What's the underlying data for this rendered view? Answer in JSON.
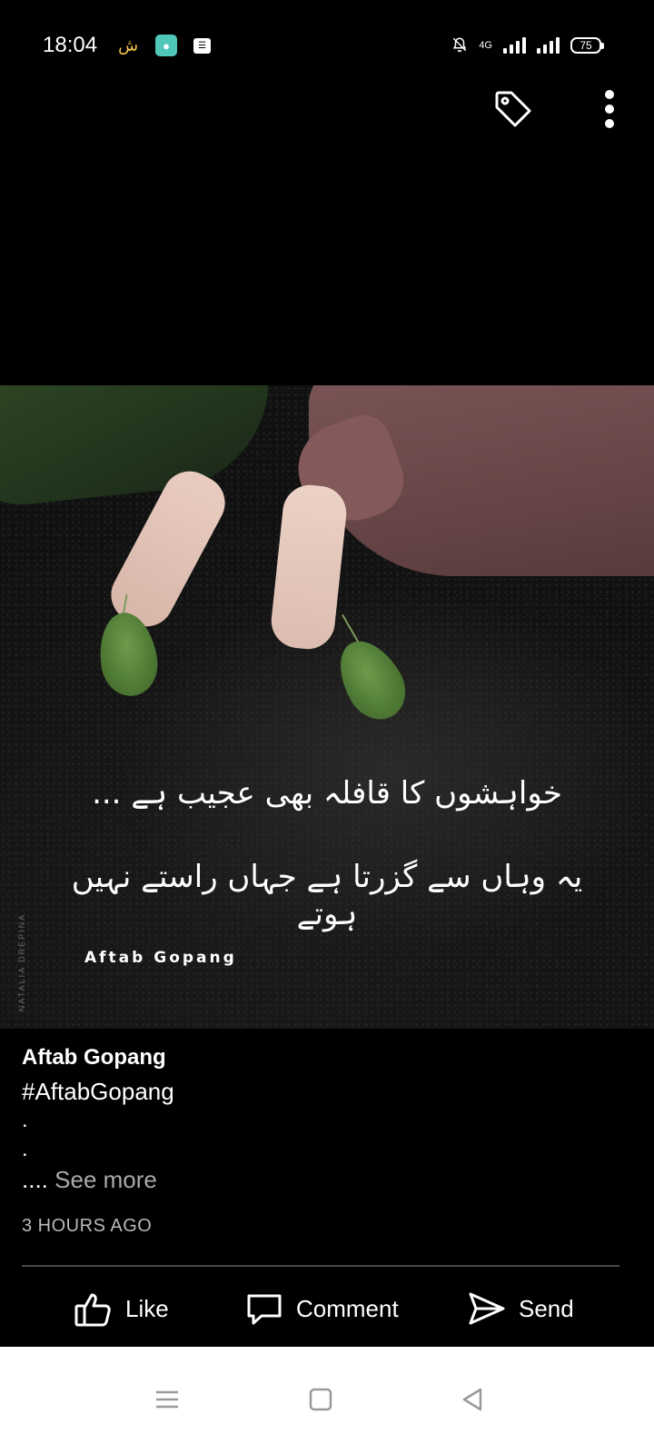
{
  "status_bar": {
    "time": "18:04",
    "network": "4G",
    "battery": "75",
    "icons": [
      "wechat-like-app-icon",
      "chat-app-icon",
      "message-icon",
      "mute-bell-icon",
      "signal-icon",
      "signal-icon"
    ]
  },
  "toolbar": {
    "icons": [
      "tag-icon",
      "more-vertical-icon"
    ]
  },
  "photo": {
    "poetry_line_1": "خواہشوں کا قافلہ بھی عجیب ہے ...",
    "poetry_line_2": "یہ وہاں سے گزرتا ہے جہاں راستے نہیں ہوتے",
    "watermark": "Aftab Gopang",
    "credit": "NATALIA DREPINA"
  },
  "post": {
    "author": "Aftab Gopang",
    "hashtag": "#AftabGopang",
    "dot_1": ".",
    "dot_2": ".",
    "ellipsis": "....",
    "see_more": "See more",
    "timestamp": "3 HOURS AGO"
  },
  "actions": {
    "like": "Like",
    "comment": "Comment",
    "send": "Send"
  },
  "nav": {
    "icons": [
      "menu-icon",
      "home-square-icon",
      "back-triangle-icon"
    ]
  },
  "colors": {
    "background": "#000000",
    "text": "#ffffff",
    "secondary_text": "#a9a9a9",
    "divider": "#4b4b4b",
    "nav_bar": "#ffffff"
  }
}
